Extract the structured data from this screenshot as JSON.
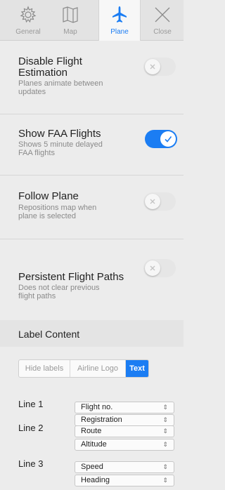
{
  "toolbar": {
    "tabs": [
      {
        "label": "General",
        "icon": "gear-icon"
      },
      {
        "label": "Map",
        "icon": "map-icon"
      },
      {
        "label": "Plane",
        "icon": "plane-icon",
        "selected": true
      },
      {
        "label": "Close",
        "icon": "close-icon"
      }
    ]
  },
  "settings": {
    "disable_estimation": {
      "title": "Disable Flight Estimation",
      "title_l1": "Disable Flight",
      "title_l2": "Estimation",
      "desc_l1": "Planes animate between",
      "desc_l2": "updates",
      "enabled": false
    },
    "faa_flights": {
      "title": "Show FAA Flights",
      "desc_l1": "Shows 5 minute delayed",
      "desc_l2": "FAA flights",
      "enabled": true
    },
    "follow_plane": {
      "title": "Follow Plane",
      "desc_l1": "Repositions map when",
      "desc_l2": "plane is selected",
      "enabled": false
    },
    "persistent_paths": {
      "title": "Persistent Flight Paths",
      "desc_l1": "Does not clear previous",
      "desc_l2": "flight paths",
      "enabled": false
    }
  },
  "label_content": {
    "heading": "Label Content",
    "options": [
      "Hide labels",
      "Airline Logo",
      "Text"
    ],
    "selected": "Text",
    "lines": [
      {
        "label": "Line 1",
        "first": "Flight no.",
        "second": "Registration"
      },
      {
        "label": "Line 2",
        "first": "Route",
        "second": "Altitude"
      },
      {
        "label": "Line 3",
        "first": "Speed",
        "second": "Heading"
      }
    ],
    "select_arrow": "⇕"
  },
  "colors": {
    "accent": "#1b7df3",
    "background": "#ececec"
  }
}
